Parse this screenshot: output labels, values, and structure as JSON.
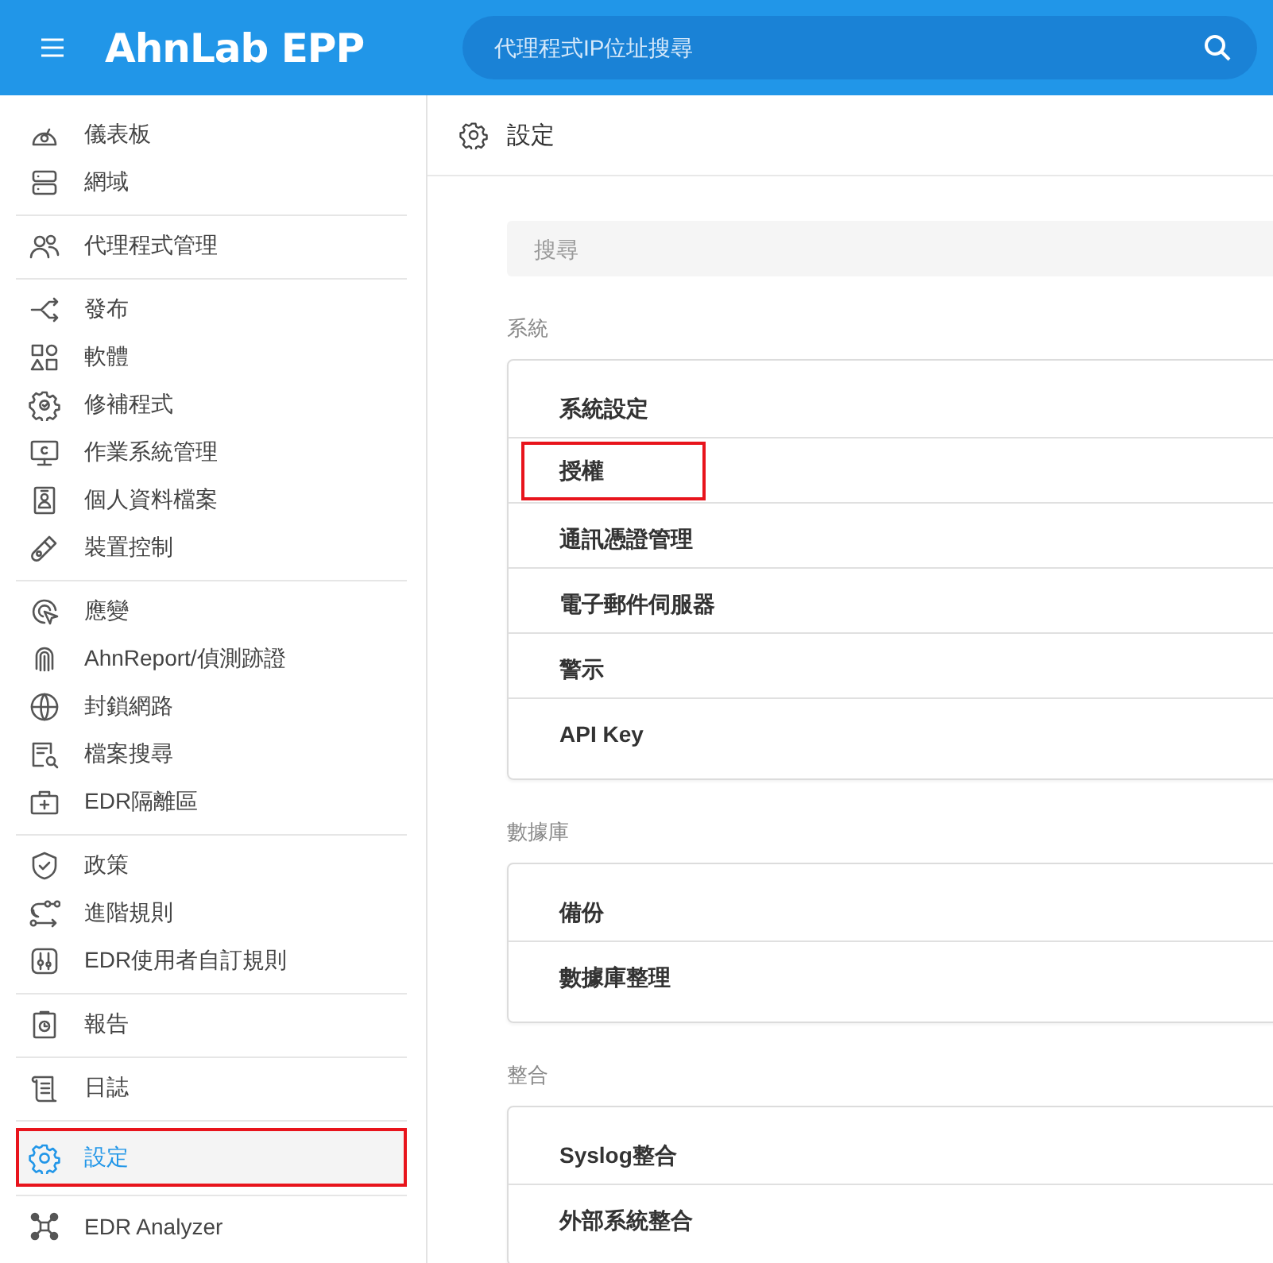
{
  "header": {
    "logo": "AhnLab EPP",
    "search": {
      "placeholder": "代理程式IP位址搜尋"
    }
  },
  "sidebar": {
    "groups": [
      [
        {
          "label": "儀表板",
          "selected": false,
          "highlighted": false
        },
        {
          "label": "網域",
          "selected": false,
          "highlighted": false
        }
      ],
      [
        {
          "label": "代理程式管理",
          "selected": false,
          "highlighted": false
        }
      ],
      [
        {
          "label": "發布",
          "selected": false,
          "highlighted": false
        },
        {
          "label": "軟體",
          "selected": false,
          "highlighted": false
        },
        {
          "label": "修補程式",
          "selected": false,
          "highlighted": false
        },
        {
          "label": "作業系統管理",
          "selected": false,
          "highlighted": false
        },
        {
          "label": "個人資料檔案",
          "selected": false,
          "highlighted": false
        },
        {
          "label": "裝置控制",
          "selected": false,
          "highlighted": false
        }
      ],
      [
        {
          "label": "應變",
          "selected": false,
          "highlighted": false
        },
        {
          "label": "AhnReport/偵測跡證",
          "selected": false,
          "highlighted": false
        },
        {
          "label": "封鎖網路",
          "selected": false,
          "highlighted": false
        },
        {
          "label": "檔案搜尋",
          "selected": false,
          "highlighted": false
        },
        {
          "label": "EDR隔離區",
          "selected": false,
          "highlighted": false
        }
      ],
      [
        {
          "label": "政策",
          "selected": false,
          "highlighted": false
        },
        {
          "label": "進階規則",
          "selected": false,
          "highlighted": false
        },
        {
          "label": "EDR使用者自訂規則",
          "selected": false,
          "highlighted": false
        }
      ],
      [
        {
          "label": "報告",
          "selected": false,
          "highlighted": false
        }
      ],
      [
        {
          "label": "日誌",
          "selected": false,
          "highlighted": false
        }
      ],
      [
        {
          "label": "設定",
          "selected": true,
          "highlighted": true
        }
      ],
      [
        {
          "label": "EDR Analyzer",
          "selected": false,
          "highlighted": false
        }
      ]
    ]
  },
  "page": {
    "title": "設定",
    "search": {
      "placeholder": "搜尋"
    },
    "sections": [
      {
        "title": "系統",
        "items": [
          {
            "label": "系統設定",
            "highlighted": false
          },
          {
            "label": "授權",
            "highlighted": true
          },
          {
            "label": "通訊憑證管理",
            "highlighted": false
          },
          {
            "label": "電子郵件伺服器",
            "highlighted": false
          },
          {
            "label": "警示",
            "highlighted": false
          },
          {
            "label": "API Key",
            "highlighted": false
          }
        ]
      },
      {
        "title": "數據庫",
        "items": [
          {
            "label": "備份",
            "highlighted": false
          },
          {
            "label": "數據庫整理",
            "highlighted": false
          }
        ]
      },
      {
        "title": "整合",
        "items": [
          {
            "label": "Syslog整合",
            "highlighted": false
          },
          {
            "label": "外部系統整合",
            "highlighted": false
          }
        ]
      }
    ]
  }
}
